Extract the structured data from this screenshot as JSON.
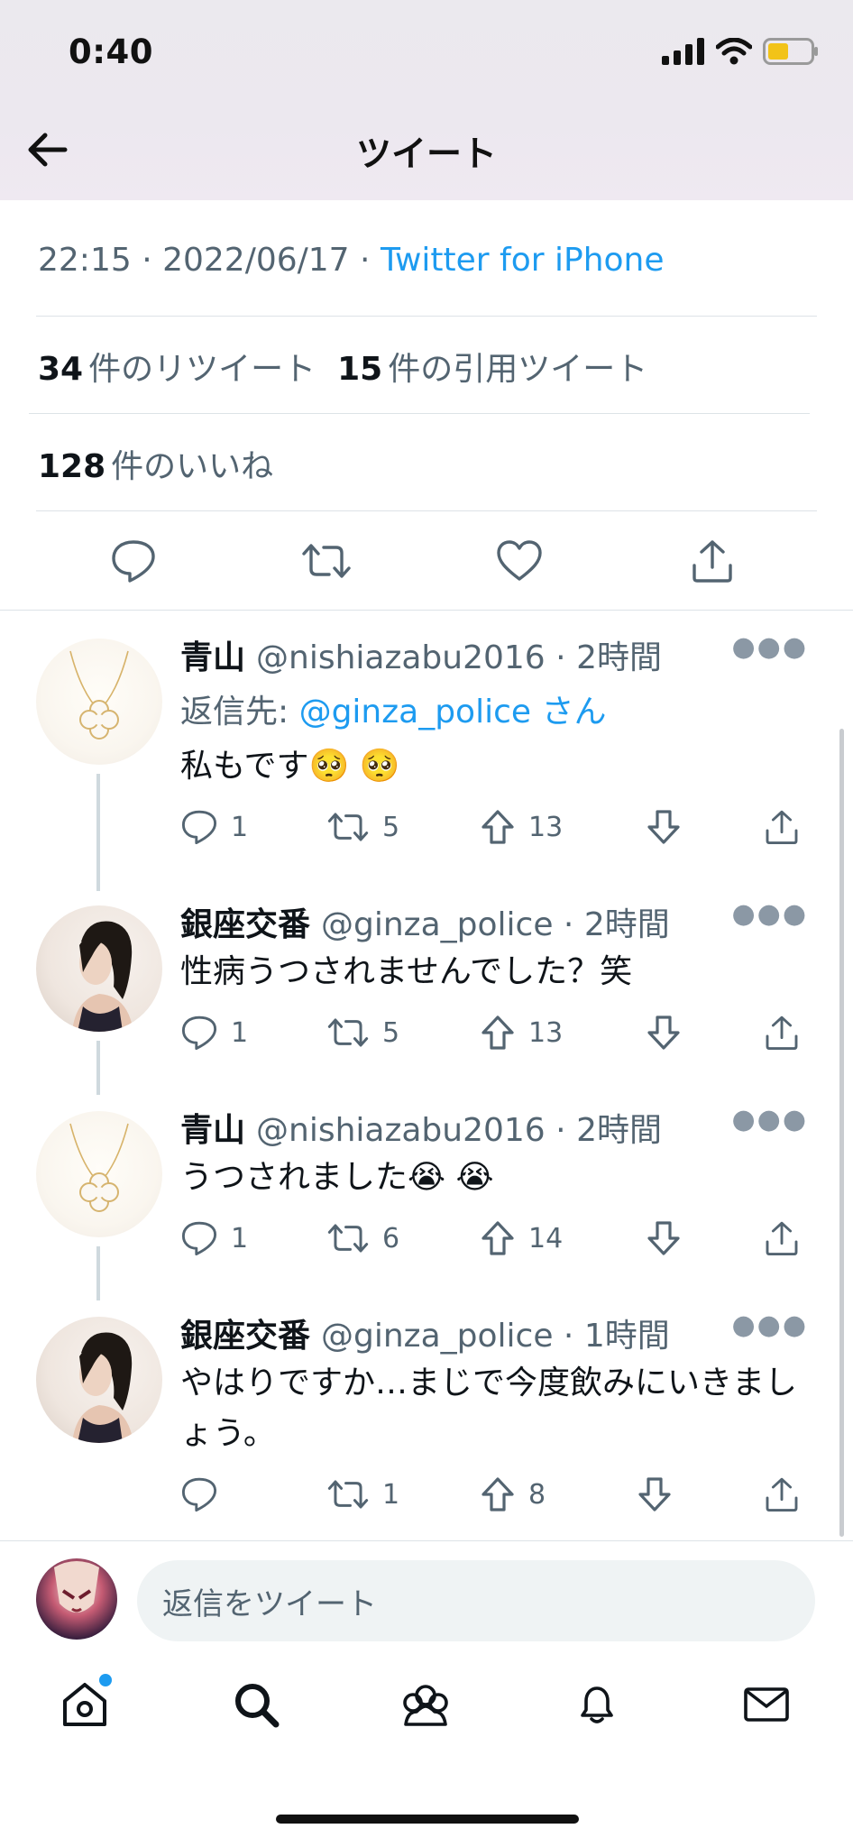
{
  "status_bar": {
    "time": "0:40"
  },
  "header": {
    "title": "ツイート"
  },
  "tweet": {
    "time": "22:15",
    "date": "2022/06/17",
    "source": "Twitter for iPhone",
    "retweets_count": "34",
    "retweets_label": "件のリツイート",
    "quotes_count": "15",
    "quotes_label": "件の引用ツイート",
    "likes_count": "128",
    "likes_label": "件のいいね"
  },
  "replies": [
    {
      "name": "青山",
      "handle": "@nishiazabu2016",
      "time": "2時間",
      "reply_to_prefix": "返信先: ",
      "reply_to_handle": "@ginza_police",
      "reply_to_suffix": "さん",
      "text": "私もです🥺 🥺",
      "reply_count": "1",
      "retweet_count": "5",
      "upvote_count": "13"
    },
    {
      "name": "銀座交番",
      "handle": "@ginza_police",
      "time": "2時間",
      "text": "性病うつされませんでした？笑",
      "reply_count": "1",
      "retweet_count": "5",
      "upvote_count": "13"
    },
    {
      "name": "青山",
      "handle": "@nishiazabu2016",
      "time": "2時間",
      "text": "うつされました😭 😭",
      "reply_count": "1",
      "retweet_count": "6",
      "upvote_count": "14"
    },
    {
      "name": "銀座交番",
      "handle": "@ginza_police",
      "time": "1時間",
      "text": "やはりですか…まじで今度飲みにいきましょう。",
      "reply_count": "",
      "retweet_count": "1",
      "upvote_count": "8"
    }
  ],
  "compose": {
    "placeholder": "返信をツイート"
  },
  "colors": {
    "accent": "#1d9bf0",
    "text": "#0f1419",
    "muted": "#536471",
    "divider": "#dde3e7"
  },
  "icons": [
    "back-arrow-icon",
    "signal-icon",
    "wifi-icon",
    "battery-icon",
    "reply-icon",
    "retweet-icon",
    "like-icon",
    "share-icon",
    "upvote-icon",
    "downvote-icon",
    "more-icon",
    "home-icon",
    "search-icon",
    "communities-icon",
    "notifications-icon",
    "messages-icon"
  ]
}
